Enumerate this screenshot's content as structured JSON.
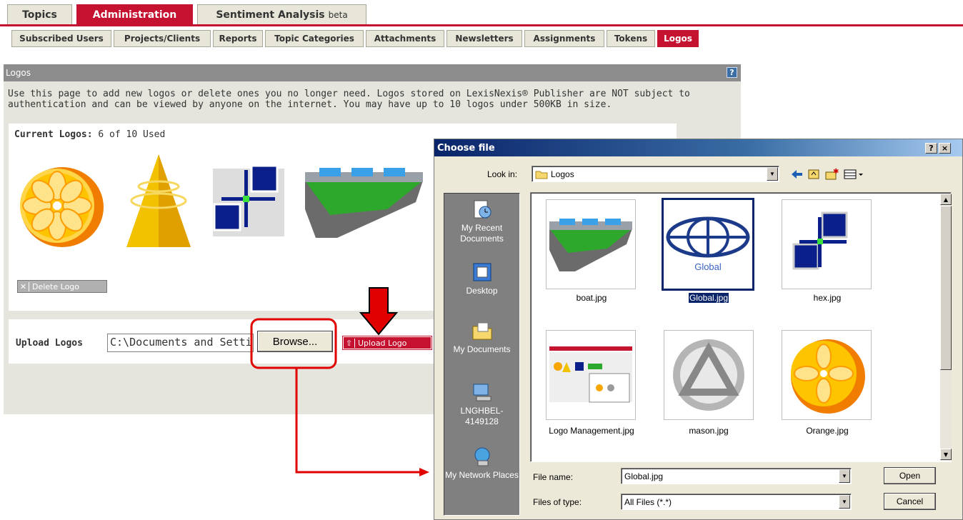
{
  "top_tabs": [
    "Topics",
    "Administration",
    "Sentiment Analysis"
  ],
  "beta_label": "beta",
  "sub_tabs": [
    "Subscribed Users",
    "Projects/Clients",
    "Reports",
    "Topic Categories",
    "Attachments",
    "Newsletters",
    "Assignments",
    "Tokens",
    "Logos"
  ],
  "panel": {
    "title": "Logos",
    "help": "?",
    "description": "Use this page to add new logos or delete ones you no longer need. Logos stored on LexisNexis® Publisher are NOT subject to authentication and can be viewed by anyone on the internet. You may have up to 10 logos under 500KB in size.",
    "current_label": "Current Logos:",
    "current_count": "6 of 10 Used",
    "delete_button": "Delete Logo",
    "upload_label": "Upload Logos",
    "upload_value": "C:\\Documents and Settings",
    "browse_button": "Browse...",
    "upload_button": "Upload Logo"
  },
  "dialog": {
    "title": "Choose file",
    "help_btn": "?",
    "close_btn": "×",
    "look_in_label": "Look in:",
    "look_in_value": "Logos",
    "places": [
      "My Recent Documents",
      "Desktop",
      "My Documents",
      "LNGHBEL-4149128",
      "My Network Places"
    ],
    "files": [
      "boat.jpg",
      "Global.jpg",
      "hex.jpg",
      "Logo Management.jpg",
      "mason.jpg",
      "Orange.jpg"
    ],
    "global_text": "Global",
    "file_name_label": "File name:",
    "file_name_value": "Global.jpg",
    "file_type_label": "Files of type:",
    "file_type_value": "All Files (*.*)",
    "open_button": "Open",
    "cancel_button": "Cancel"
  },
  "colors": {
    "accent": "#c41230",
    "dialog_title": "#0a246a",
    "panel_header": "#8c8c8c"
  },
  "icons": [
    "orange-logo-icon",
    "cone-logo-icon",
    "hex-logo-icon",
    "boat-logo-icon",
    "folder-icon",
    "back-icon",
    "up-folder-icon",
    "new-folder-icon",
    "view-menu-icon",
    "recent-docs-icon",
    "desktop-icon",
    "my-documents-icon",
    "computer-icon",
    "network-icon",
    "mason-logo-icon",
    "global-logo-icon",
    "screenshot-thumb-icon",
    "down-arrow-icon",
    "upload-icon",
    "delete-x-icon"
  ]
}
